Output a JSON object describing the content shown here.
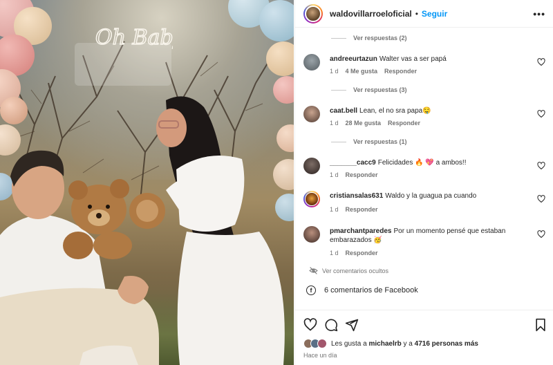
{
  "post": {
    "username": "waldovillarroeloficial",
    "separator": "•",
    "follow_label": "Seguir",
    "more_icon": "more-horizontal-icon",
    "photo": {
      "sign_text": "Oh Baby"
    }
  },
  "comments": {
    "threads": [
      {
        "replies_label": "Ver respuestas (2)"
      },
      {
        "username": "andreeurtazun",
        "text": "Walter vas a ser papá",
        "time": "1 d",
        "likes": "4 Me gusta",
        "reply_label": "Responder",
        "replies_label": "Ver respuestas (3)"
      },
      {
        "username": "caat.bell",
        "text": "Lean, el no sra papa🤤",
        "time": "1 d",
        "likes": "28 Me gusta",
        "reply_label": "Responder",
        "replies_label": "Ver respuestas (1)"
      },
      {
        "username": "_______cacc9",
        "text": "Felicidades 🔥 💖 a ambos!!",
        "time": "1 d",
        "reply_label": "Responder"
      },
      {
        "username": "cristiansalas631",
        "text": "Waldo y la guagua pa cuando",
        "time": "1 d",
        "reply_label": "Responder"
      },
      {
        "username": "pmarchantparedes",
        "text": "Por un momento pensé que estaban embarazados 🥳",
        "time": "1 d",
        "reply_label": "Responder"
      }
    ],
    "hidden_label": "Ver comentarios ocultos",
    "facebook_label": "6 comentarios de Facebook"
  },
  "footer": {
    "likes_prefix": "Les gusta a ",
    "likes_user": "michaelrb",
    "likes_middle": " y a ",
    "likes_count": "4716 personas más",
    "time": "Hace un día"
  },
  "colors": {
    "accent": "#0095f6",
    "text": "#262626",
    "muted": "#737373"
  }
}
